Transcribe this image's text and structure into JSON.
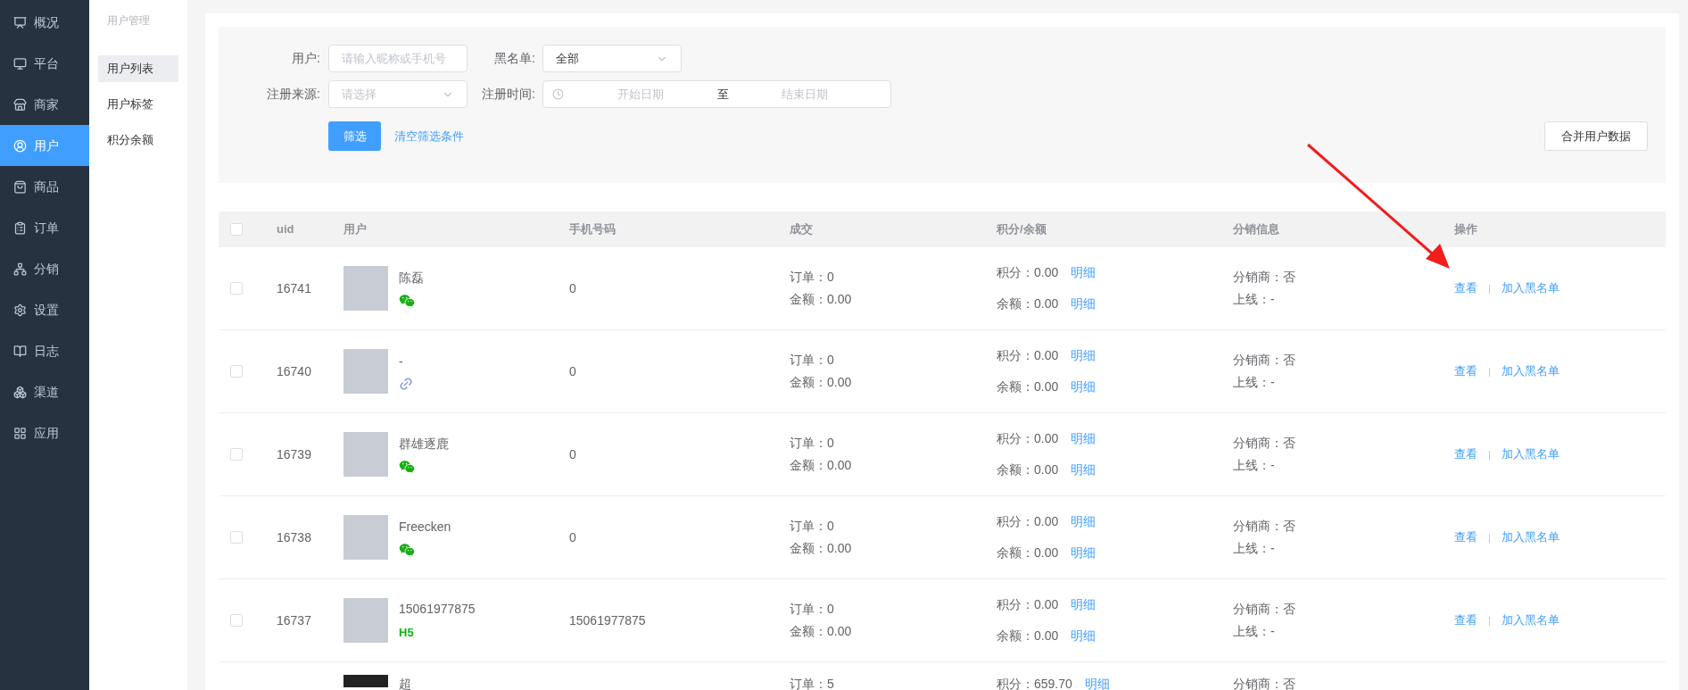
{
  "sidebar": {
    "items": [
      {
        "label": "概况",
        "selected": false
      },
      {
        "label": "平台",
        "selected": false
      },
      {
        "label": "商家",
        "selected": false
      },
      {
        "label": "用户",
        "selected": true
      },
      {
        "label": "商品",
        "selected": false
      },
      {
        "label": "订单",
        "selected": false
      },
      {
        "label": "分销",
        "selected": false
      },
      {
        "label": "设置",
        "selected": false
      },
      {
        "label": "日志",
        "selected": false
      },
      {
        "label": "渠道",
        "selected": false
      },
      {
        "label": "应用",
        "selected": false
      }
    ]
  },
  "submenu": {
    "title": "用户管理",
    "items": [
      {
        "label": "用户列表",
        "selected": true
      },
      {
        "label": "用户标签",
        "selected": false
      },
      {
        "label": "积分余额",
        "selected": false
      }
    ]
  },
  "filters": {
    "user": {
      "label": "用户:",
      "placeholder": "请输入昵称或手机号"
    },
    "blacklist": {
      "label": "黑名单:",
      "value": "全部"
    },
    "source": {
      "label": "注册来源:",
      "placeholder": "请选择"
    },
    "time": {
      "label": "注册时间:",
      "start_placeholder": "开始日期",
      "separator": "至",
      "end_placeholder": "结束日期"
    },
    "filter_button": "筛选",
    "clear_link": "清空筛选条件",
    "merge_button": "合并用户数据"
  },
  "table": {
    "select_all_checked": false,
    "columns": [
      "uid",
      "用户",
      "手机号码",
      "成交",
      "积分/余额",
      "分销信息",
      "操作"
    ],
    "rows": [
      {
        "checked": false,
        "uid": "16741",
        "name": "陈磊",
        "source": {
          "kind": "wechat"
        },
        "phone": "0",
        "orders": "订单：0",
        "amount": "金额：0.00",
        "points": "积分：0.00",
        "points_link": "明细",
        "balance": "余额：0.00",
        "balance_link": "明细",
        "distributor": "分销商：否",
        "upline": "上线：-",
        "view": "查看",
        "sep": "|",
        "block": "加入黑名单"
      },
      {
        "checked": false,
        "uid": "16740",
        "name": "-",
        "source": {
          "kind": "link"
        },
        "phone": "0",
        "orders": "订单：0",
        "amount": "金额：0.00",
        "points": "积分：0.00",
        "points_link": "明细",
        "balance": "余额：0.00",
        "balance_link": "明细",
        "distributor": "分销商：否",
        "upline": "上线：-",
        "view": "查看",
        "sep": "|",
        "block": "加入黑名单"
      },
      {
        "checked": false,
        "uid": "16739",
        "name": "群雄逐鹿",
        "source": {
          "kind": "wechat"
        },
        "phone": "0",
        "orders": "订单：0",
        "amount": "金额：0.00",
        "points": "积分：0.00",
        "points_link": "明细",
        "balance": "余额：0.00",
        "balance_link": "明细",
        "distributor": "分销商：否",
        "upline": "上线：-",
        "view": "查看",
        "sep": "|",
        "block": "加入黑名单"
      },
      {
        "checked": false,
        "uid": "16738",
        "name": "Freecken",
        "source": {
          "kind": "wechat"
        },
        "phone": "0",
        "orders": "订单：0",
        "amount": "金额：0.00",
        "points": "积分：0.00",
        "points_link": "明细",
        "balance": "余额：0.00",
        "balance_link": "明细",
        "distributor": "分销商：否",
        "upline": "上线：-",
        "view": "查看",
        "sep": "|",
        "block": "加入黑名单"
      },
      {
        "checked": false,
        "uid": "16737",
        "name": "15061977875",
        "source": {
          "kind": "h5",
          "label": "H5"
        },
        "phone": "15061977875",
        "orders": "订单：0",
        "amount": "金额：0.00",
        "points": "积分：0.00",
        "points_link": "明细",
        "balance": "余额：0.00",
        "balance_link": "明细",
        "distributor": "分销商：否",
        "upline": "上线：-",
        "view": "查看",
        "sep": "|",
        "block": "加入黑名单"
      }
    ],
    "partial_row": {
      "name": "超",
      "orders": "订单：5",
      "points": "积分：659.70",
      "points_link": "明细",
      "distributor": "分销商：否"
    }
  }
}
